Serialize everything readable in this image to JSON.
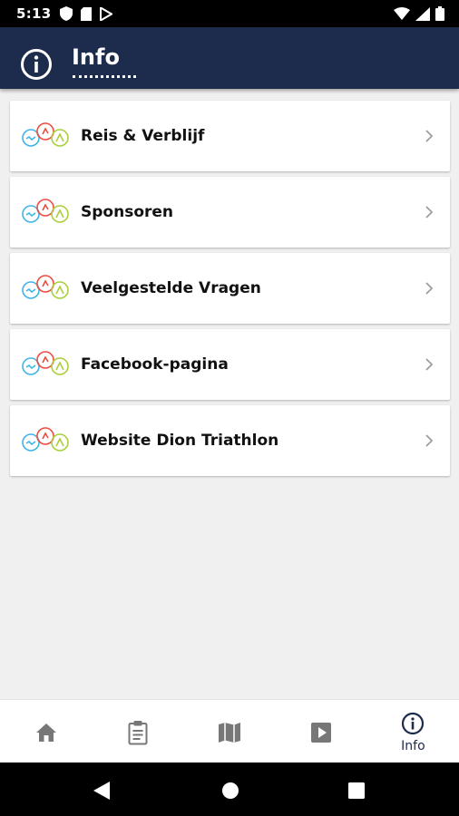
{
  "status_bar": {
    "time": "5:13",
    "left_icons": [
      "shield-icon",
      "sd-card-icon",
      "play-store-icon"
    ],
    "right_icons": [
      "wifi-icon",
      "signal-icon",
      "battery-icon"
    ]
  },
  "app_bar": {
    "title": "Info",
    "icon": "info-icon",
    "background": "#1d2b4c"
  },
  "list": {
    "items": [
      {
        "label": "Reis & Verblijf",
        "icon": "triathlon-logo-icon"
      },
      {
        "label": "Sponsoren",
        "icon": "triathlon-logo-icon"
      },
      {
        "label": "Veelgestelde Vragen",
        "icon": "triathlon-logo-icon"
      },
      {
        "label": "Facebook-pagina",
        "icon": "triathlon-logo-icon"
      },
      {
        "label": "Website Dion Triathlon",
        "icon": "triathlon-logo-icon"
      }
    ]
  },
  "bottom_nav": {
    "items": [
      {
        "icon": "home-icon",
        "label": ""
      },
      {
        "icon": "clipboard-icon",
        "label": ""
      },
      {
        "icon": "map-icon",
        "label": ""
      },
      {
        "icon": "video-icon",
        "label": ""
      },
      {
        "icon": "info-icon",
        "label": "Info"
      }
    ],
    "active_index": 4,
    "active_color": "#1d2b4c",
    "inactive_color": "#777777"
  },
  "system_nav": {
    "icons": [
      "back-icon",
      "home-circle-icon",
      "recents-icon"
    ]
  }
}
